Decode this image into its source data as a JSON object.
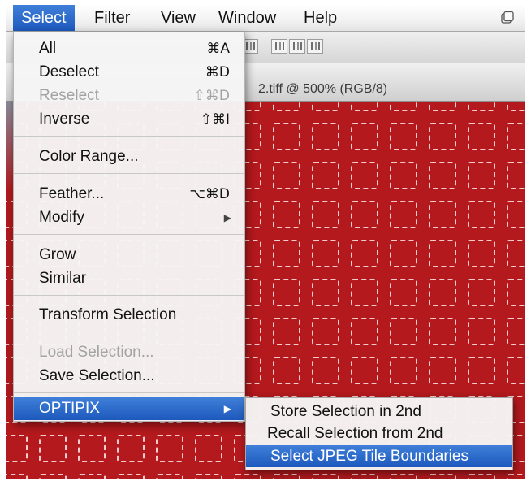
{
  "menubar": {
    "items": [
      "Select",
      "Filter",
      "View",
      "Window",
      "Help"
    ],
    "active": "Select"
  },
  "document": {
    "title": "2.tiff @ 500% (RGB/8)",
    "canvas_color": "#b3191d"
  },
  "select_menu": {
    "items": [
      {
        "label": "All",
        "shortcut": "⌘A",
        "enabled": true
      },
      {
        "label": "Deselect",
        "shortcut": "⌘D",
        "enabled": true
      },
      {
        "label": "Reselect",
        "shortcut": "⇧⌘D",
        "enabled": false
      },
      {
        "label": "Inverse",
        "shortcut": "⇧⌘I",
        "enabled": true
      },
      {
        "label": "Color Range...",
        "shortcut": "",
        "enabled": true
      },
      {
        "label": "Feather...",
        "shortcut": "⌥⌘D",
        "enabled": true
      },
      {
        "label": "Modify",
        "shortcut": "",
        "submenu": true,
        "enabled": true
      },
      {
        "label": "Grow",
        "shortcut": "",
        "enabled": true
      },
      {
        "label": "Similar",
        "shortcut": "",
        "enabled": true
      },
      {
        "label": "Transform Selection",
        "shortcut": "",
        "enabled": true
      },
      {
        "label": "Load Selection...",
        "shortcut": "",
        "enabled": false
      },
      {
        "label": "Save Selection...",
        "shortcut": "",
        "enabled": true
      },
      {
        "label": "OPTIPIX",
        "shortcut": "",
        "submenu": true,
        "enabled": true,
        "highlighted": true
      }
    ]
  },
  "optipix_submenu": {
    "items": [
      {
        "label": "Store Selection in 2nd",
        "highlighted": false
      },
      {
        "label": "Recall Selection from 2nd",
        "highlighted": false
      },
      {
        "label": "Select JPEG Tile Boundaries",
        "highlighted": true
      }
    ]
  },
  "colors": {
    "menu_highlight": "#2a6bd0",
    "canvas_red": "#b3191d",
    "selection_marquee": "#ffe9e9"
  },
  "icons": {
    "menubar_right": "window-icon",
    "submenu_arrow": "triangle-right-icon"
  }
}
